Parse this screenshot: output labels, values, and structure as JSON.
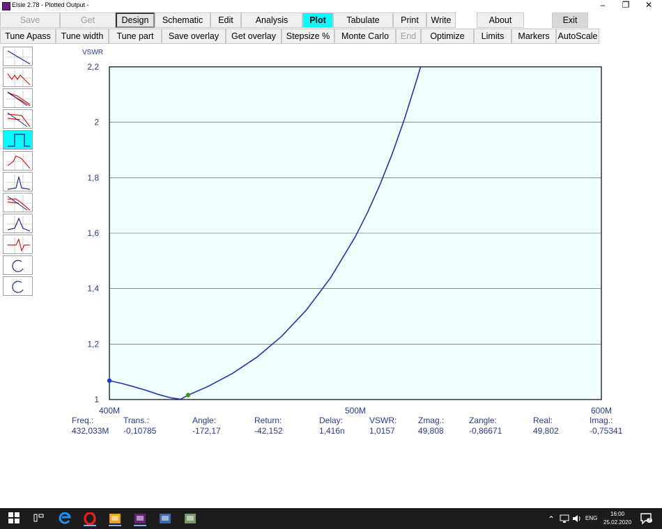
{
  "window": {
    "title": "Elsie 2.78 - Plotted Output -",
    "minimize": "–",
    "restore": "❐",
    "close": "✕"
  },
  "toolbar1": [
    {
      "label": "Save",
      "state": "disabled"
    },
    {
      "label": "Get",
      "state": "disabled"
    },
    {
      "label": "Design",
      "state": "pressed"
    },
    {
      "label": "Schematic",
      "state": "normal"
    },
    {
      "label": "Edit",
      "state": "normal"
    },
    {
      "label": "Analysis",
      "state": "normal"
    },
    {
      "label": "Plot",
      "state": "active"
    },
    {
      "label": "Tabulate",
      "state": "normal"
    },
    {
      "label": "Print",
      "state": "normal"
    },
    {
      "label": "Write",
      "state": "normal"
    },
    {
      "label": "About",
      "state": "normal"
    },
    {
      "label": "Exit",
      "state": "exit"
    }
  ],
  "toolbar2": [
    {
      "label": "Tune Apass",
      "state": "normal"
    },
    {
      "label": "Tune width",
      "state": "normal"
    },
    {
      "label": "Tune part",
      "state": "normal"
    },
    {
      "label": "Save overlay",
      "state": "normal"
    },
    {
      "label": "Get overlay",
      "state": "normal"
    },
    {
      "label": "Stepsize %",
      "state": "normal"
    },
    {
      "label": "Monte Carlo",
      "state": "normal"
    },
    {
      "label": "End",
      "state": "disabled"
    },
    {
      "label": "Optimize",
      "state": "normal"
    },
    {
      "label": "Limits",
      "state": "normal"
    },
    {
      "label": "Markers",
      "state": "normal"
    },
    {
      "label": "AutoScale",
      "state": "normal"
    }
  ],
  "side_icons": [
    "lowpass-response-icon",
    "ripple-response-icon",
    "lowpass-overlay-icon",
    "rolloff-response-icon",
    "step-response-icon",
    "group-delay-icon",
    "bandpass-response-icon",
    "bandpass-overlay-icon",
    "peak-response-icon",
    "phase-response-icon",
    "smith-chart-icon",
    "polar-chart-icon"
  ],
  "active_side_icon": 4,
  "chart_data": {
    "type": "line",
    "ylabel": "VSWR",
    "xlim": [
      400,
      600
    ],
    "ylim": [
      1,
      2.2
    ],
    "yticks": [
      "1",
      "1,2",
      "1,4",
      "1,6",
      "1,8",
      "2",
      "2,2"
    ],
    "xticks": [
      "400M",
      "500M",
      "600M"
    ],
    "grid": true,
    "series": [
      {
        "color": "#2233aa",
        "points": [
          [
            400,
            1.068
          ],
          [
            405,
            1.058
          ],
          [
            410,
            1.046
          ],
          [
            415,
            1.033
          ],
          [
            420,
            1.018
          ],
          [
            425,
            1.006
          ],
          [
            429,
            1.001
          ],
          [
            432,
            1.016
          ],
          [
            440,
            1.047
          ],
          [
            450,
            1.094
          ],
          [
            460,
            1.153
          ],
          [
            470,
            1.228
          ],
          [
            480,
            1.322
          ],
          [
            490,
            1.44
          ],
          [
            500,
            1.588
          ],
          [
            505,
            1.676
          ],
          [
            510,
            1.775
          ],
          [
            515,
            1.887
          ],
          [
            520,
            2.013
          ],
          [
            525,
            2.155
          ],
          [
            526.5,
            2.2
          ]
        ]
      }
    ],
    "markers": [
      {
        "x": 400,
        "y": 1.068,
        "color": "#1a3ad8"
      },
      {
        "x": 432,
        "y": 1.016,
        "color": "#3a9a20"
      }
    ]
  },
  "readouts": [
    {
      "label": "Freq.:",
      "value": "432,033M"
    },
    {
      "label": "Trans.:",
      "value": "-0,10785"
    },
    {
      "label": "Angle:",
      "value": "-172,17"
    },
    {
      "label": "Return:",
      "value": "-42,152"
    },
    {
      "label": "Delay:",
      "value": "1,416n"
    },
    {
      "label": "VSWR:",
      "value": "1,0157"
    },
    {
      "label": "Zmag.:",
      "value": "49,808"
    },
    {
      "label": "Zangle:",
      "value": "-0,86671"
    },
    {
      "label": "Real:",
      "value": "49,802"
    },
    {
      "label": "Imag.:",
      "value": "-0,75341"
    }
  ],
  "taskbar": {
    "apps": [
      "windows-start-icon",
      "task-view-icon",
      "edge-icon",
      "opera-icon",
      "charts-app-icon",
      "elsie-app-icon",
      "remote-app-icon",
      "browser-app-icon"
    ],
    "tray_up": "⌃",
    "tray_icons": [
      "network-icon",
      "volume-icon"
    ],
    "language": "ENG",
    "time": "16:00",
    "date": "25.02.2020",
    "notification_count": "2"
  }
}
